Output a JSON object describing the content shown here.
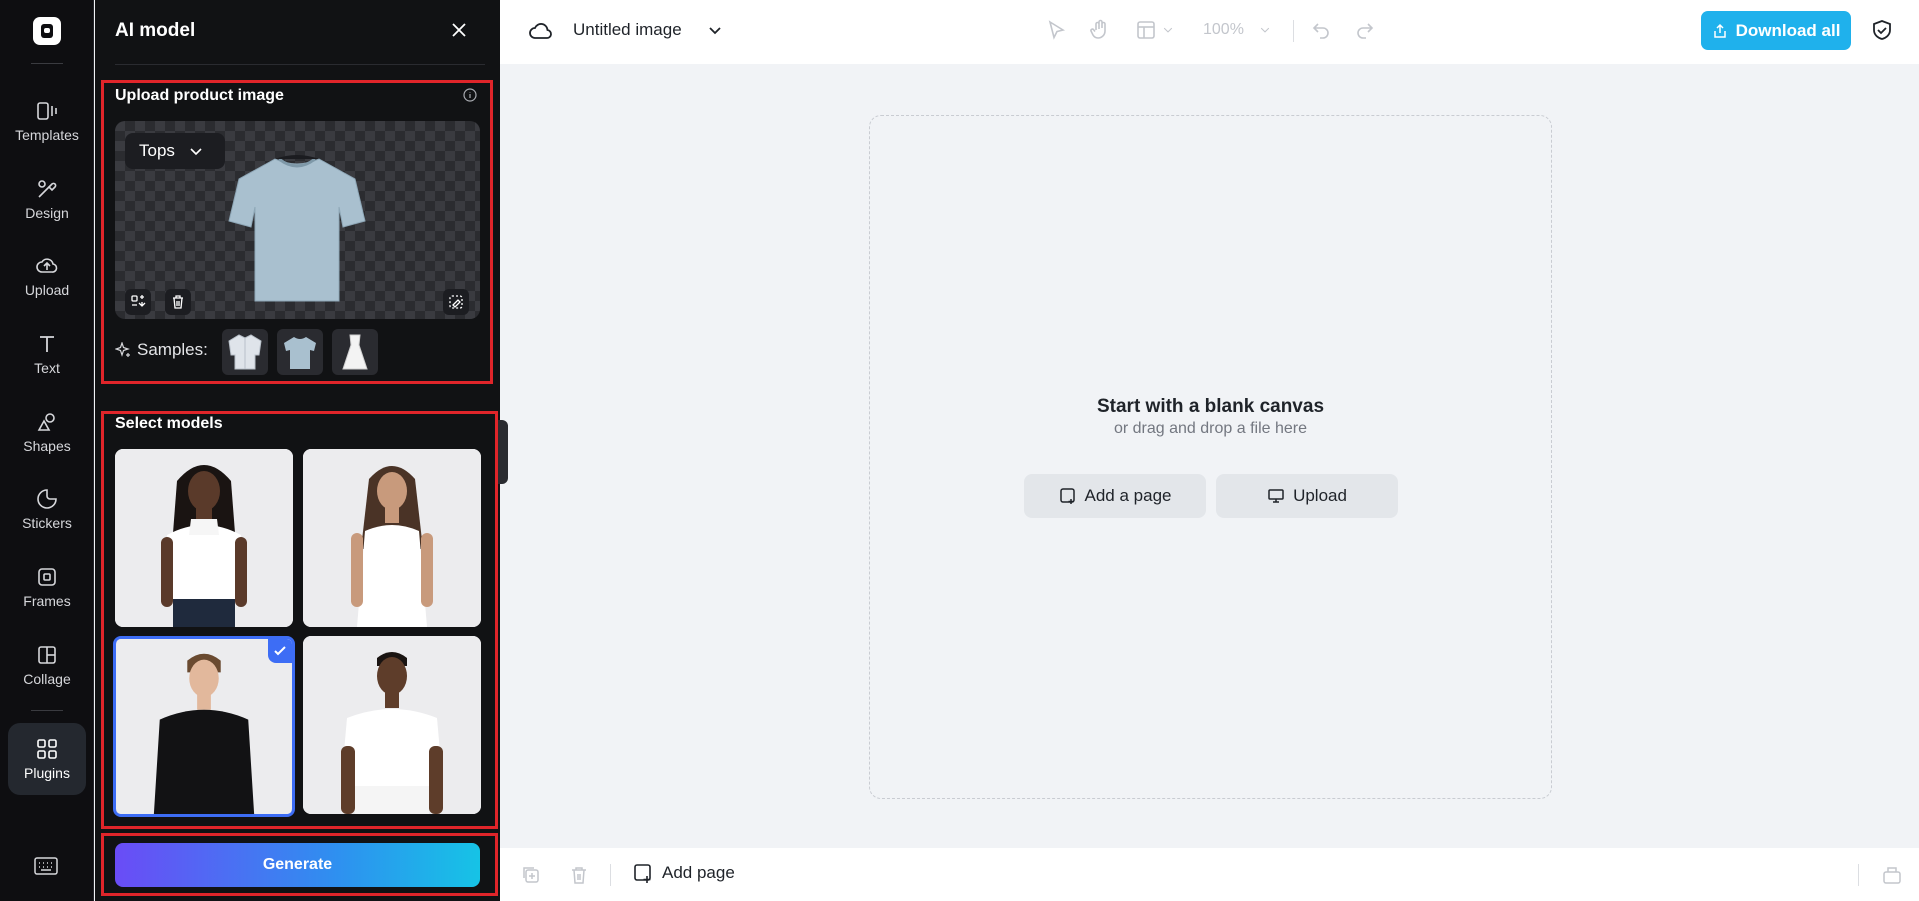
{
  "rail": {
    "items": [
      {
        "label": "Templates"
      },
      {
        "label": "Design"
      },
      {
        "label": "Upload"
      },
      {
        "label": "Text"
      },
      {
        "label": "Shapes"
      },
      {
        "label": "Stickers"
      },
      {
        "label": "Frames"
      },
      {
        "label": "Collage"
      },
      {
        "label": "Plugins",
        "active": true
      }
    ]
  },
  "panel": {
    "title": "AI model",
    "upload_section": {
      "title": "Upload product image",
      "category_select": "Tops",
      "samples_label": "Samples:"
    },
    "models_section": {
      "title": "Select models",
      "selected_index": 2
    },
    "generate_label": "Generate"
  },
  "topbar": {
    "doc_title": "Untitled image",
    "zoom": "100%",
    "download_label": "Download all"
  },
  "canvas": {
    "title": "Start with a blank canvas",
    "subtitle": "or drag and drop a file here",
    "add_page_label": "Add a page",
    "upload_label": "Upload"
  },
  "bottombar": {
    "add_page_label": "Add page"
  },
  "colors": {
    "accent_blue": "#1fb1ec",
    "selection_blue": "#3d6df5",
    "highlight_red": "#e0252a"
  }
}
